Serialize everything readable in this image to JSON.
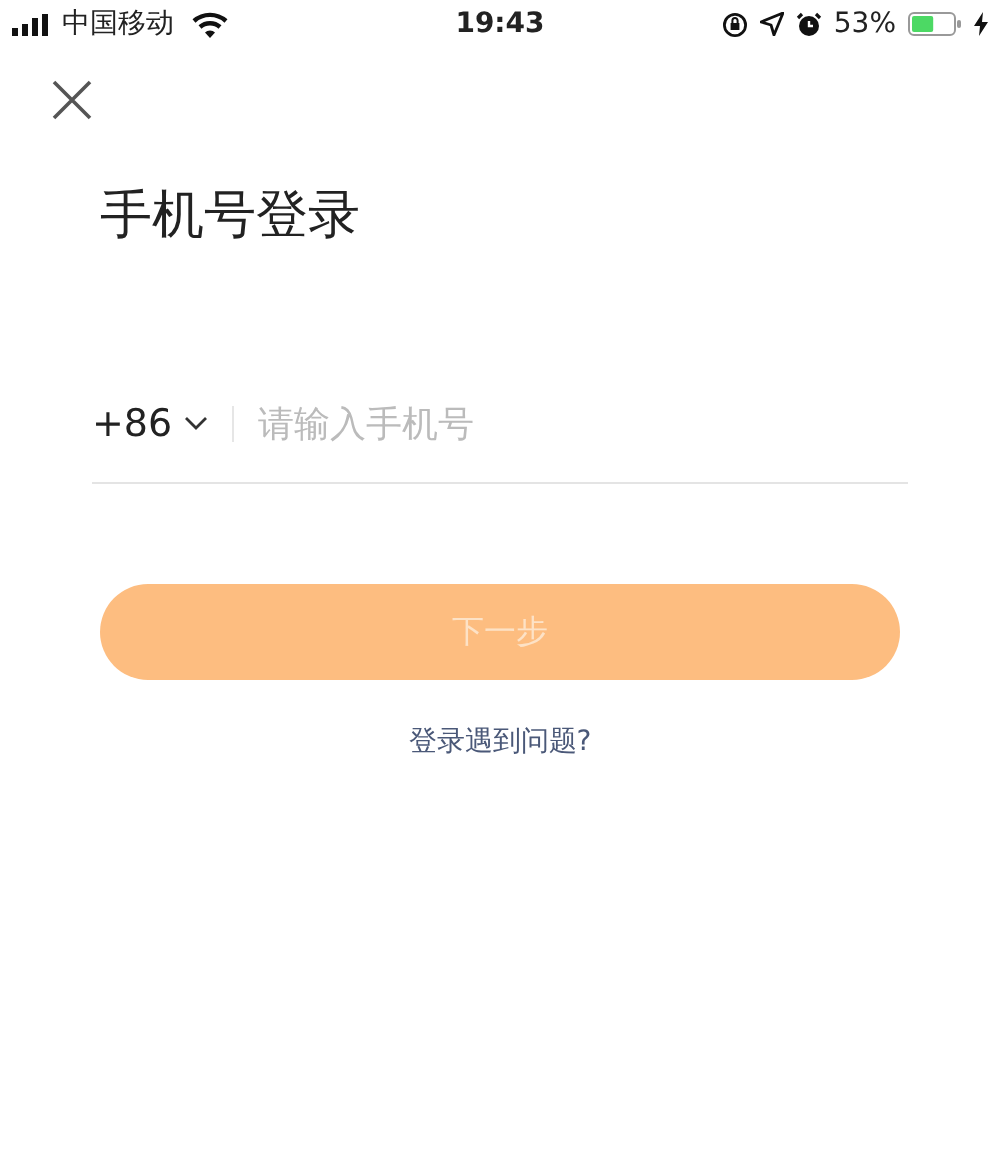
{
  "status_bar": {
    "carrier": "中国移动",
    "time": "19:43",
    "battery_percent": "53%"
  },
  "title": "手机号登录",
  "phone": {
    "country_code": "+86",
    "placeholder": "请输入手机号"
  },
  "next_button": {
    "label": "下一步",
    "disabled": true
  },
  "help_link": "登录遇到问题?"
}
